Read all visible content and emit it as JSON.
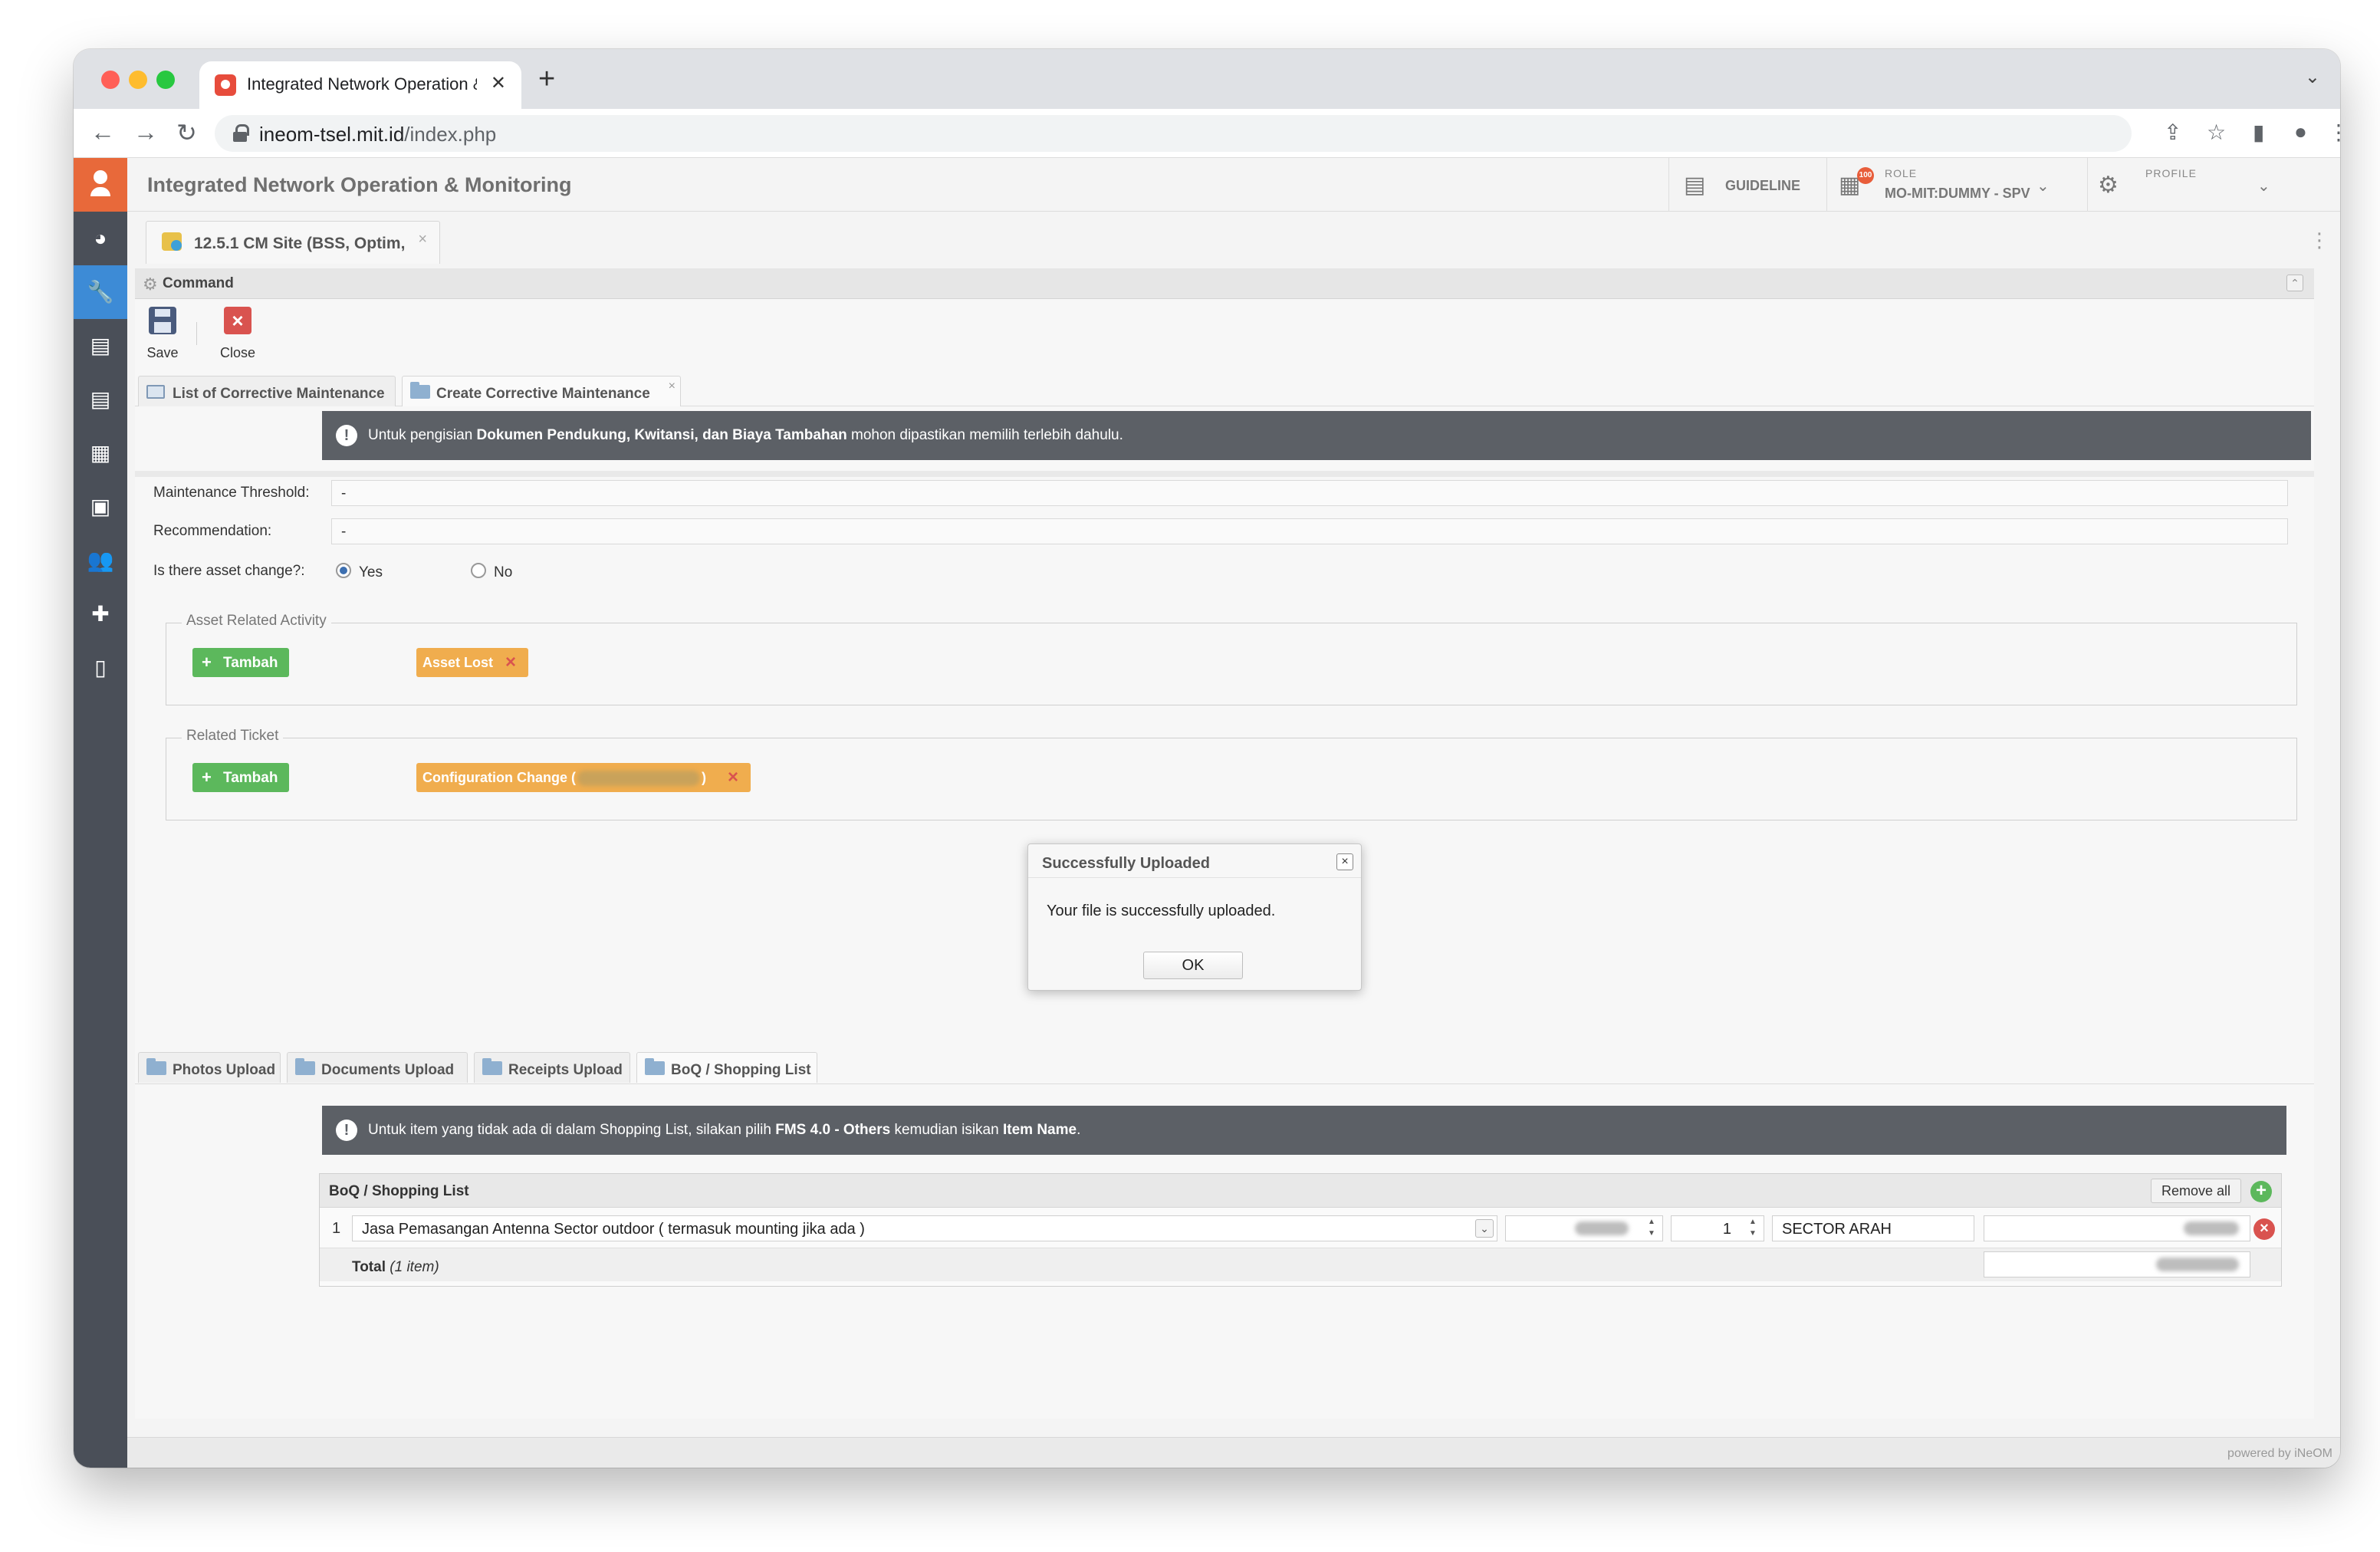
{
  "browser": {
    "tab_title": "Integrated Network Operation &",
    "new_tab_icon": "plus-icon",
    "url_host": "ineom-tsel.mit.id",
    "url_path": "/index.php"
  },
  "app": {
    "title": "Integrated Network Operation & Monitoring",
    "guideline_label": "GUIDELINE",
    "role_caption": "ROLE",
    "role_value": "MO-MIT:DUMMY - SPV",
    "role_badge": "100",
    "profile_caption": "PROFILE"
  },
  "sidebar": {
    "items": [
      "dashboard-icon",
      "wrench-icon",
      "clipboard-icon",
      "clipboard-list-icon",
      "server-icon",
      "archive-icon",
      "users-icon",
      "puzzle-icon",
      "book-icon"
    ],
    "active": "wrench-icon"
  },
  "page_tab": {
    "title": "12.5.1 CM Site (BSS, Optim,"
  },
  "command": {
    "title": "Command",
    "save_label": "Save",
    "close_label": "Close"
  },
  "subtabs": {
    "list_label": "List of Corrective Maintenance",
    "create_label": "Create Corrective Maintenance"
  },
  "notice_top": {
    "pre": "Untuk pengisian ",
    "bold": "Dokumen Pendukung, Kwitansi, dan Biaya Tambahan",
    "post": " mohon dipastikan memilih terlebih dahulu."
  },
  "form": {
    "threshold_label": "Maintenance Threshold:",
    "threshold_value": "-",
    "recommendation_label": "Recommendation:",
    "recommendation_value": "-",
    "asset_change_label": "Is there asset change?:",
    "yes_label": "Yes",
    "no_label": "No",
    "asset_change_selected": "Yes"
  },
  "asset_activity": {
    "legend": "Asset Related Activity",
    "add_label": "Tambah",
    "tag": "Asset Lost"
  },
  "related_ticket": {
    "legend": "Related Ticket",
    "add_label": "Tambah",
    "tag_pre": "Configuration Change (",
    "tag_post": ")"
  },
  "lower_tabs": {
    "photos": "Photos Upload",
    "documents": "Documents Upload",
    "receipts": "Receipts Upload",
    "boq": "BoQ / Shopping List"
  },
  "notice_boq": {
    "pre": "Untuk item yang tidak ada di dalam Shopping List, silakan pilih ",
    "bold1": "FMS 4.0 - Others",
    "mid": " kemudian isikan ",
    "bold2": "Item Name",
    "post": "."
  },
  "boq": {
    "title": "BoQ / Shopping List",
    "remove_all": "Remove all",
    "row_number": "1",
    "item": "Jasa Pemasangan Antenna Sector outdoor ( termasuk mounting jika ada )",
    "quantity": "1",
    "note": "SECTOR ARAH",
    "total_label": "Total",
    "total_count": "(1 item)"
  },
  "footer": {
    "powered": "powered by iNeOM"
  },
  "modal": {
    "title": "Successfully Uploaded",
    "message": "Your file is successfully uploaded.",
    "ok": "OK"
  },
  "colors": {
    "sidebar": "#4a4f58",
    "sidebar_active": "#3d8bd6",
    "logo": "#e8693a",
    "notice": "#5c6066",
    "green": "#5cb85c",
    "tag": "#f0ad4e",
    "danger": "#d9534f"
  }
}
